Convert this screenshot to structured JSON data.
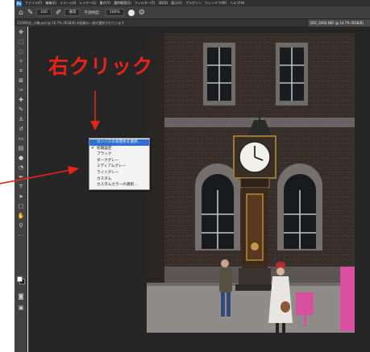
{
  "menubar": {
    "logo": "Ps",
    "items": [
      "ファイル(F)",
      "編集(E)",
      "イメージ(I)",
      "レイヤー(L)",
      "書式(Y)",
      "選択範囲(S)",
      "フィルター(T)",
      "3D(D)",
      "表示(V)",
      "プラグイン",
      "ウィンドウ(W)",
      "ヘルプ(H)"
    ]
  },
  "options": {
    "size_value": "100",
    "mode_value": "通常",
    "opacity_label": "不透明度：",
    "opacity_value": "100%"
  },
  "tabs": {
    "tab1": "2509阿佐_小樽.psd @ 16.7% (RGB/8)  ※画像の一部が選択されています",
    "tab2": "DSC_6464.NEF @ 14.7% (RGB/8)"
  },
  "annotation": {
    "title": "右クリック"
  },
  "context_menu": {
    "items": [
      {
        "label": "カンバスの背景色を選択...",
        "highlight": true,
        "checked": false
      },
      {
        "label": "初期設定",
        "highlight": false,
        "checked": true
      },
      {
        "label": "ブラック",
        "highlight": false,
        "checked": false
      },
      {
        "label": "ダークグレー",
        "highlight": false,
        "checked": false
      },
      {
        "label": "ミディアムグレー",
        "highlight": false,
        "checked": false
      },
      {
        "label": "ライトグレー",
        "highlight": false,
        "checked": false
      },
      {
        "label": "カスタム",
        "highlight": false,
        "checked": false
      },
      {
        "label": "カスタムカラーの選択...",
        "highlight": false,
        "checked": false
      }
    ]
  },
  "colors": {
    "accent_red": "#e8231a",
    "menu_highlight": "#2f6fd1",
    "ui_dark": "#262626"
  }
}
